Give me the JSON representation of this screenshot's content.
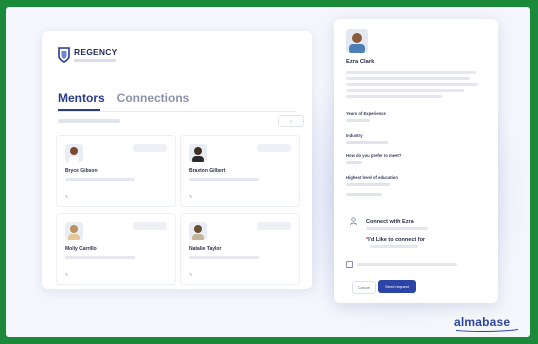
{
  "brand": {
    "name": "REGENCY",
    "shield_color": "#2a3a8c"
  },
  "tabs": [
    {
      "label": "Mentors",
      "active": true
    },
    {
      "label": "Connections",
      "active": false
    }
  ],
  "mentors": [
    {
      "name": "Bryce Gibson",
      "avatar_bg": "#7a4a2e"
    },
    {
      "name": "Braxton Gilbert",
      "avatar_bg": "#3e2e22"
    },
    {
      "name": "Molly Carrillo",
      "avatar_bg": "#b9905e"
    },
    {
      "name": "Natalie Taylor",
      "avatar_bg": "#6a4f37"
    }
  ],
  "profile": {
    "name": "Ezra Clark",
    "fields": [
      {
        "label": "Years of Experience"
      },
      {
        "label": "Industry"
      },
      {
        "label": "How do you prefer to meet?"
      },
      {
        "label": "Highest level of education"
      }
    ],
    "connect_title": "Connect with Ezra",
    "request_label": "I'd Like to connect for",
    "cancel_label": "Cancel",
    "send_label": "Send request"
  },
  "wordmark": "almabase",
  "colors": {
    "accent": "#2c44a6",
    "frame": "#1a8a3a"
  }
}
